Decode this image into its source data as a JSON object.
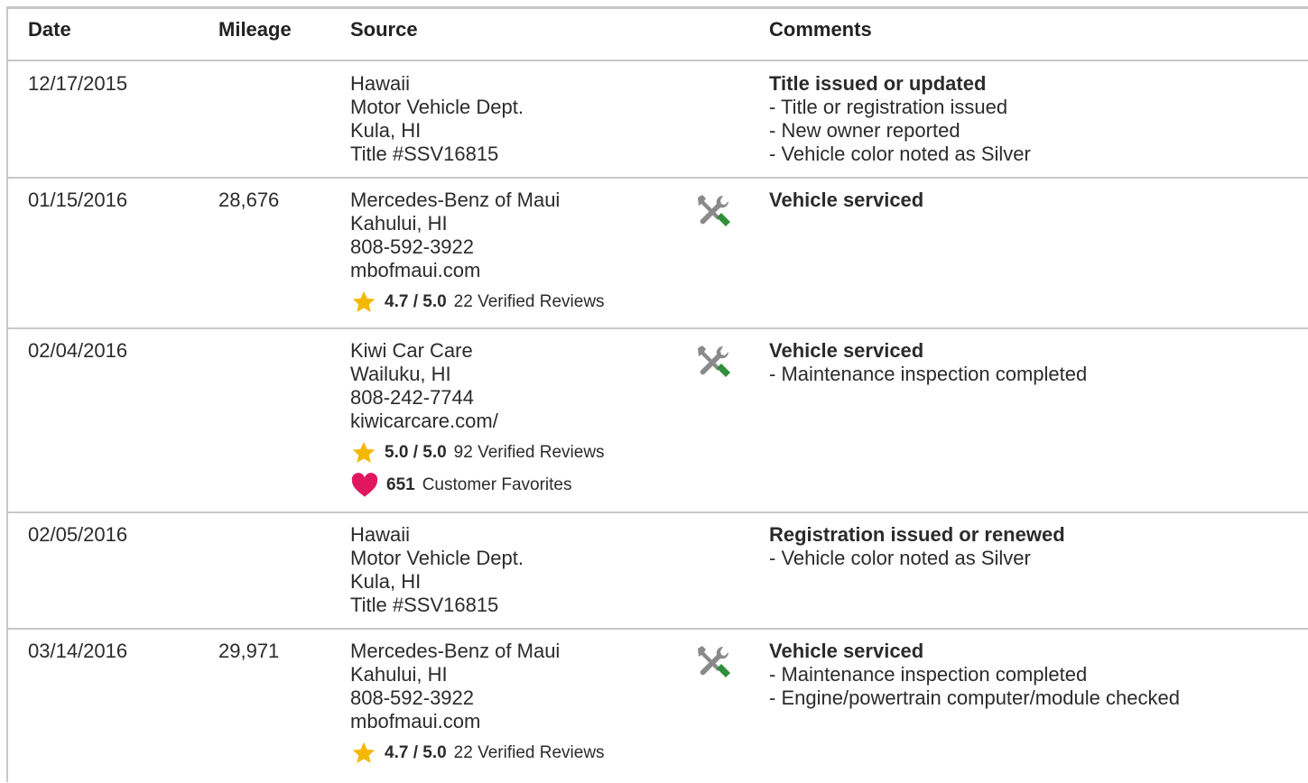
{
  "columns": {
    "date": "Date",
    "mileage": "Mileage",
    "source": "Source",
    "comments": "Comments"
  },
  "records": [
    {
      "date": "12/17/2015",
      "mileage": "",
      "source": [
        "Hawaii",
        "Motor Vehicle Dept.",
        "Kula, HI",
        "Title #SSV16815"
      ],
      "comment_title": "Title issued or updated",
      "comments": [
        "Title or registration issued",
        "New owner reported",
        "Vehicle color noted as Silver"
      ]
    },
    {
      "date": "01/15/2016",
      "mileage": "28,676",
      "source": [
        "Mercedes-Benz of Maui",
        "Kahului, HI",
        "808-592-3922",
        "mbofmaui.com"
      ],
      "rating": {
        "score": "4.7 / 5.0",
        "reviews": "22 Verified Reviews"
      },
      "service_icon": "service-tools-icon",
      "comment_title": "Vehicle serviced",
      "comments": []
    },
    {
      "date": "02/04/2016",
      "mileage": "",
      "source": [
        "Kiwi Car Care",
        "Wailuku, HI",
        "808-242-7744",
        "kiwicarcare.com/"
      ],
      "rating": {
        "score": "5.0 / 5.0",
        "reviews": "92 Verified Reviews"
      },
      "favorites": {
        "count": "651",
        "label": "Customer Favorites"
      },
      "service_icon": "service-tools-icon",
      "comment_title": "Vehicle serviced",
      "comments": [
        "Maintenance inspection completed"
      ]
    },
    {
      "date": "02/05/2016",
      "mileage": "",
      "source": [
        "Hawaii",
        "Motor Vehicle Dept.",
        "Kula, HI",
        "Title #SSV16815"
      ],
      "comment_title": "Registration issued or renewed",
      "comments": [
        "Vehicle color noted as Silver"
      ]
    },
    {
      "date": "03/14/2016",
      "mileage": "29,971",
      "source": [
        "Mercedes-Benz of Maui",
        "Kahului, HI",
        "808-592-3922",
        "mbofmaui.com"
      ],
      "rating": {
        "score": "4.7 / 5.0",
        "reviews": "22 Verified Reviews"
      },
      "service_icon": "service-tools-icon",
      "comment_title": "Vehicle serviced",
      "comments": [
        "Maintenance inspection completed",
        "Engine/powertrain computer/module checked"
      ]
    }
  ],
  "colors": {
    "star": "#f5b800",
    "heart": "#e0175f",
    "wrench": "#8a8a8a",
    "screwdriver": "#2f8f3a",
    "border": "#c8c8c8"
  }
}
